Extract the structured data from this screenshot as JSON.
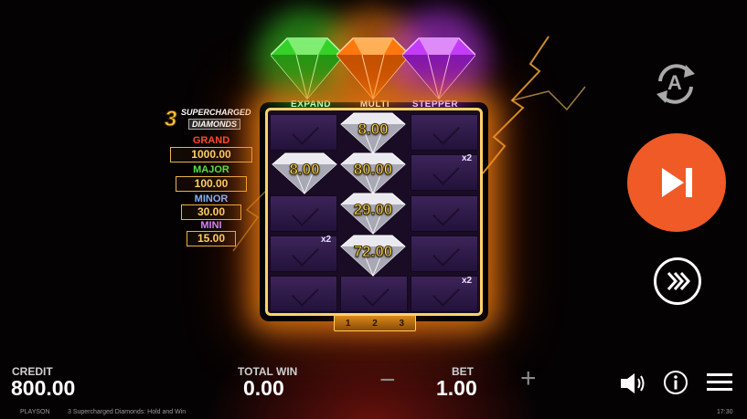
{
  "gems": {
    "expand_label": "EXPAND",
    "multi_label": "MULTI",
    "stepper_label": "STEPPER",
    "colors": {
      "expand": "#2fd62a",
      "multi": "#ff7a10",
      "stepper": "#c13cff"
    }
  },
  "jackpots": {
    "logo_number": "3",
    "logo_line1": "SUPERCHARGED",
    "logo_line2": "DIAMONDS",
    "grand_label": "GRAND",
    "grand_value": "1000.00",
    "major_label": "MAJOR",
    "major_value": "100.00",
    "minor_label": "MINOR",
    "minor_value": "30.00",
    "mini_label": "MINI",
    "mini_value": "15.00"
  },
  "reels": {
    "diamonds": [
      {
        "value": "8.00"
      },
      {
        "value": "8.00"
      },
      {
        "value": "80.00"
      },
      {
        "value": "29.00"
      },
      {
        "value": "72.00"
      }
    ],
    "multipliers": [
      "x2",
      "x2",
      "x2"
    ],
    "pages": [
      "1",
      "2",
      "3"
    ]
  },
  "controls": {
    "autoplay_letter": "A",
    "accent_color": "#ef5a26"
  },
  "bottom": {
    "credit_label": "CREDIT",
    "credit_value": "800.00",
    "total_win_label": "TOTAL WIN",
    "total_win_value": "0.00",
    "bet_label": "BET",
    "bet_value": "1.00",
    "minus": "−",
    "plus": "+",
    "provider": "PLAYSON",
    "game_name": "3 Supercharged Diamonds: Hold and Win",
    "clock": "17:30"
  }
}
